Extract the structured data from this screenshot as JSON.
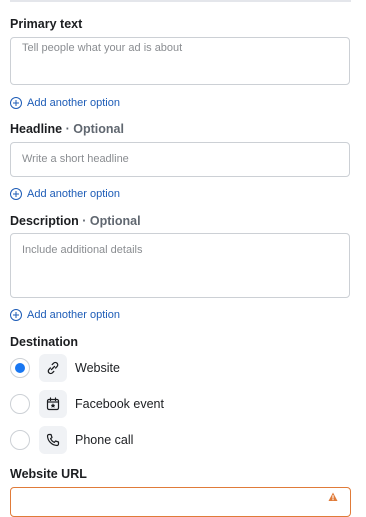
{
  "primary_text": {
    "label": "Primary text",
    "placeholder": "Tell people what your ad is about",
    "add_option": "Add another option"
  },
  "headline": {
    "label": "Headline",
    "optional": "· Optional",
    "placeholder": "Write a short headline",
    "add_option": "Add another option"
  },
  "description": {
    "label": "Description",
    "optional": "· Optional",
    "placeholder": "Include additional details",
    "add_option": "Add another option"
  },
  "destination": {
    "label": "Destination",
    "options": [
      {
        "label": "Website",
        "icon": "link-icon",
        "selected": true
      },
      {
        "label": "Facebook event",
        "icon": "calendar-star-icon",
        "selected": false
      },
      {
        "label": "Phone call",
        "icon": "phone-icon",
        "selected": false
      }
    ]
  },
  "website_url": {
    "label": "Website URL",
    "value": "",
    "status_icon": "warning-icon"
  },
  "colors": {
    "link": "#1d5cb7",
    "radio_selected": "#1877f2",
    "warning_border": "#e07b39"
  }
}
